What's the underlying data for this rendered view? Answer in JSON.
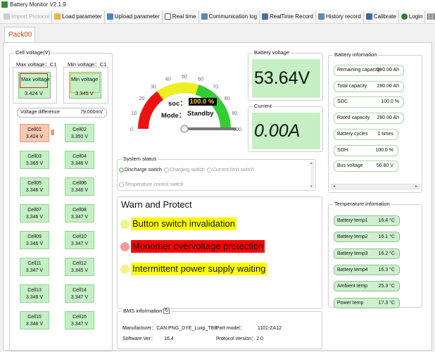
{
  "window": {
    "title": "Battery Monitor V2.1.9"
  },
  "toolbar": {
    "import": "Import Protocol",
    "load": "Load parameter",
    "upload": "Upload parameter",
    "realtime": "Real time",
    "commlog": "Communication log",
    "rtrecord": "RealTime Record",
    "history": "History record",
    "calibrate": "Calibrate",
    "login": "Login",
    "lang": "EN"
  },
  "tab": {
    "label": "Pack00"
  },
  "cellgroup": {
    "title": "Cell voltage(V)",
    "max_label": "Max voltage：C1",
    "max_inner": "Max voltage",
    "max_value": "3.424 V",
    "min_label": "Min voltage：C1",
    "min_inner": "Min voltage",
    "min_value": "3.345 V",
    "diff_label": "Voltage difference",
    "diff_value": "79.000mV"
  },
  "cells": [
    {
      "name": "Cell01",
      "value": "3.424 V"
    },
    {
      "name": "Cell02",
      "value": "3.350 V"
    },
    {
      "name": "Cell03",
      "value": "3.365 V"
    },
    {
      "name": "Cell04",
      "value": "3.346 V"
    },
    {
      "name": "Cell05",
      "value": "3.346 V"
    },
    {
      "name": "Cell06",
      "value": "3.346 V"
    },
    {
      "name": "Cell07",
      "value": "3.346 V"
    },
    {
      "name": "Cell08",
      "value": "3.347 V"
    },
    {
      "name": "Cell09",
      "value": "3.346 V"
    },
    {
      "name": "Cell10",
      "value": "3.347 V"
    },
    {
      "name": "Cell11",
      "value": "3.347 V"
    },
    {
      "name": "Cell12",
      "value": "3.345 V"
    },
    {
      "name": "Cell13",
      "value": "3.346 V"
    },
    {
      "name": "Cell14",
      "value": "3.347 V"
    },
    {
      "name": "Cell15",
      "value": "3.348 V"
    },
    {
      "name": "Cell16",
      "value": "3.347 V"
    }
  ],
  "gauge": {
    "ticks": [
      "0",
      "10",
      "20",
      "30",
      "40",
      "50",
      "60",
      "70",
      "80",
      "90",
      "100"
    ],
    "soc_label": "soc：",
    "soc_value": "100.0 %",
    "mode_label": "Mode：",
    "mode_value": "Standby",
    "soc_fraction": 1.0
  },
  "battery_voltage": {
    "title": "Battery voltage",
    "value": "53.64V"
  },
  "current": {
    "title": "Current",
    "value": "0.00A"
  },
  "battery_info": {
    "title": "Battery infomation",
    "rows": [
      {
        "label": "Remaining capacity",
        "value": "280.00 Ah"
      },
      {
        "label": "Total capacity",
        "value": "280.00 Ah"
      },
      {
        "label": "SOC",
        "value": "100.0 %"
      },
      {
        "label": "Rated capacity",
        "value": "280.00 Ah"
      },
      {
        "label": "Battery cycles",
        "value": "1 times"
      },
      {
        "label": "SOH",
        "value": "100.0 %"
      },
      {
        "label": "Bus voltage",
        "value": "56.80 V"
      }
    ]
  },
  "system_status": {
    "title": "System status",
    "discharge": "Discharge switch",
    "charging": "Charging switch",
    "current_limit": "Current limit switch",
    "temp_control": "Temperature control switch"
  },
  "warn": {
    "title": "Warn and Protect",
    "items": [
      {
        "text": "Button switch invalidation",
        "bg": "#ffff00",
        "dot": "#f3f38c"
      },
      {
        "text": "Monomer overvoltage protection",
        "bg": "#ff0000",
        "dot": "#f59a9a"
      },
      {
        "text": "Intermittent power supply waiting",
        "bg": "#ffff00",
        "dot": "#f3f38c"
      }
    ]
  },
  "temperature": {
    "title": "Temperature infomation",
    "rows": [
      {
        "label": "Battery temp1",
        "value": "16.4 °C"
      },
      {
        "label": "Battery temp2",
        "value": "16.1 °C"
      },
      {
        "label": "Battery temp3",
        "value": "16.2 °C"
      },
      {
        "label": "Battery temp4",
        "value": "16.3 °C"
      },
      {
        "label": "Ambient temp",
        "value": "25.3 °C"
      },
      {
        "label": "Power temp",
        "value": "17.3 °C"
      }
    ]
  },
  "bms": {
    "title": "BMS information",
    "manufacturer_label": "Manufacturer：",
    "manufacturer_value": "CAN:PNG_DYE_Luxp_TBB",
    "model_label": "Part model：",
    "model_value": "1101-ZA12",
    "software_label": "Software Ver：",
    "software_value": "16.4",
    "protocol_label": "Protocol version：",
    "protocol_value": "2.0"
  },
  "colors": {
    "accent_green": "#c4f0c4",
    "gauge_red": "#ee1111",
    "gauge_yellow": "#eeee22",
    "gauge_green": "#33cc33",
    "tab_text": "#d03a10"
  }
}
